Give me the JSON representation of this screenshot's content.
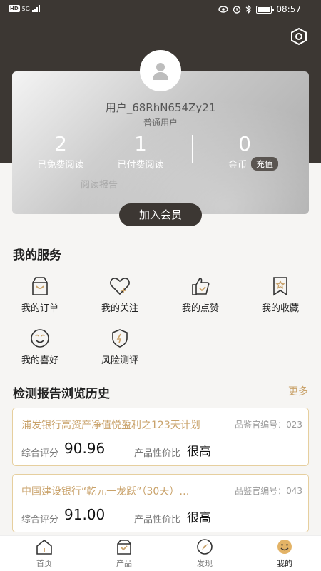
{
  "status": {
    "left_hd": "HD",
    "left_sig": "5G",
    "time": "08:57"
  },
  "profile": {
    "username": "用户_68RhN654Zy21",
    "usertype": "普通用户",
    "free_count": "2",
    "free_label": "已免费阅读",
    "paid_count": "1",
    "paid_label": "已付费阅读",
    "coin_count": "0",
    "coin_label": "金币",
    "recharge_label": "充值",
    "report_link": "阅读报告",
    "join_label": "加入会员"
  },
  "services": {
    "title": "我的服务",
    "items": [
      {
        "label": "我的订单",
        "icon": "shopping-bag-icon"
      },
      {
        "label": "我的关注",
        "icon": "heart-plus-icon"
      },
      {
        "label": "我的点赞",
        "icon": "thumbs-up-icon"
      },
      {
        "label": "我的收藏",
        "icon": "bookmark-star-icon"
      },
      {
        "label": "我的喜好",
        "icon": "smile-icon"
      },
      {
        "label": "风险测评",
        "icon": "shield-bolt-icon"
      }
    ]
  },
  "history": {
    "title": "检测报告浏览历史",
    "more": "更多",
    "items": [
      {
        "title": "浦发银行高资产净值悦盈利之123天计划",
        "code": "品鉴官编号：023",
        "score_label": "综合评分",
        "score": "90.96",
        "value_label": "产品性价比",
        "value": "很高"
      },
      {
        "title": "中国建设银行“乾元一龙跃”（30天）…",
        "code": "品鉴官编号：043",
        "score_label": "综合评分",
        "score": "91.00",
        "value_label": "产品性价比",
        "value": "很高"
      }
    ]
  },
  "tabs": [
    {
      "label": "首页",
      "icon": "home-icon"
    },
    {
      "label": "产品",
      "icon": "product-bag-icon"
    },
    {
      "label": "发现",
      "icon": "compass-icon"
    },
    {
      "label": "我的",
      "icon": "profile-smile-icon",
      "active": true
    }
  ],
  "colors": {
    "dark": "#3c3733",
    "accent": "#c9a26a",
    "card_border": "#e6cf9e"
  }
}
